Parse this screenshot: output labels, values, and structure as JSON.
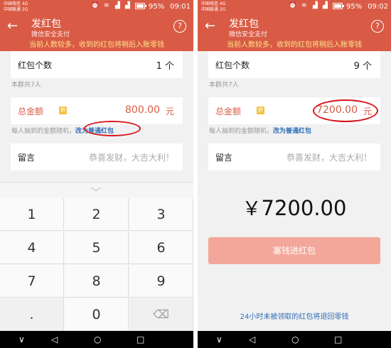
{
  "status": {
    "carrier1": "中国电信 4G",
    "carrier2": "中国联通 2G",
    "battery": "95%",
    "battery_level": 0.95,
    "time_left": "09:01",
    "time_right": "09:02"
  },
  "appbar": {
    "title": "发红包",
    "subtitle": "微信安全支付",
    "help": "?"
  },
  "notice": "当前人数较多，收到的红包将稍后入账零钱",
  "left": {
    "count_label": "红包个数",
    "count_value": "1 个",
    "group_hint": "本群共7人",
    "amount_label": "总金额",
    "amount_badge": "拼",
    "amount_value": "800.00",
    "amount_unit": "元",
    "random_hint": "每人抽到的金额随机，",
    "switch_link": "改为普通红包",
    "message_label": "留言",
    "message_placeholder": "恭喜发财，大吉大利！"
  },
  "right": {
    "count_label": "红包个数",
    "count_value": "9 个",
    "group_hint": "本群共7人",
    "amount_label": "总金额",
    "amount_badge": "拼",
    "amount_value": "7200.00",
    "amount_value_visible": "7200.00",
    "amount_unit": "元",
    "random_hint": "每人抽到的金额随机，",
    "switch_link": "改为普通红包",
    "message_label": "留言",
    "message_placeholder": "恭喜发财，大吉大利！",
    "big_amount_symbol": "￥",
    "big_amount": "7200.00",
    "pay_button": "塞钱进红包",
    "refund_note": "24小时未被领取的红包将退回零钱"
  },
  "keypad": {
    "keys": [
      "1",
      "2",
      "3",
      "4",
      "5",
      "6",
      "7",
      "8",
      "9",
      ".",
      "0",
      "⌫"
    ]
  },
  "navbar": {
    "down": "∨",
    "back": "◁",
    "home": "○",
    "recent": "□"
  },
  "colors": {
    "brand": "#d95b45",
    "link": "#2f6fb8",
    "notice_text": "#ffe08a",
    "button_disabled": "#f3a79a",
    "annotation": "#d8141a"
  },
  "icons": {
    "back": "arrow-left-icon",
    "help": "question-circle-icon",
    "wifi": "wifi-icon",
    "signal": "signal-icon",
    "battery": "battery-icon",
    "backspace": "backspace-icon"
  }
}
